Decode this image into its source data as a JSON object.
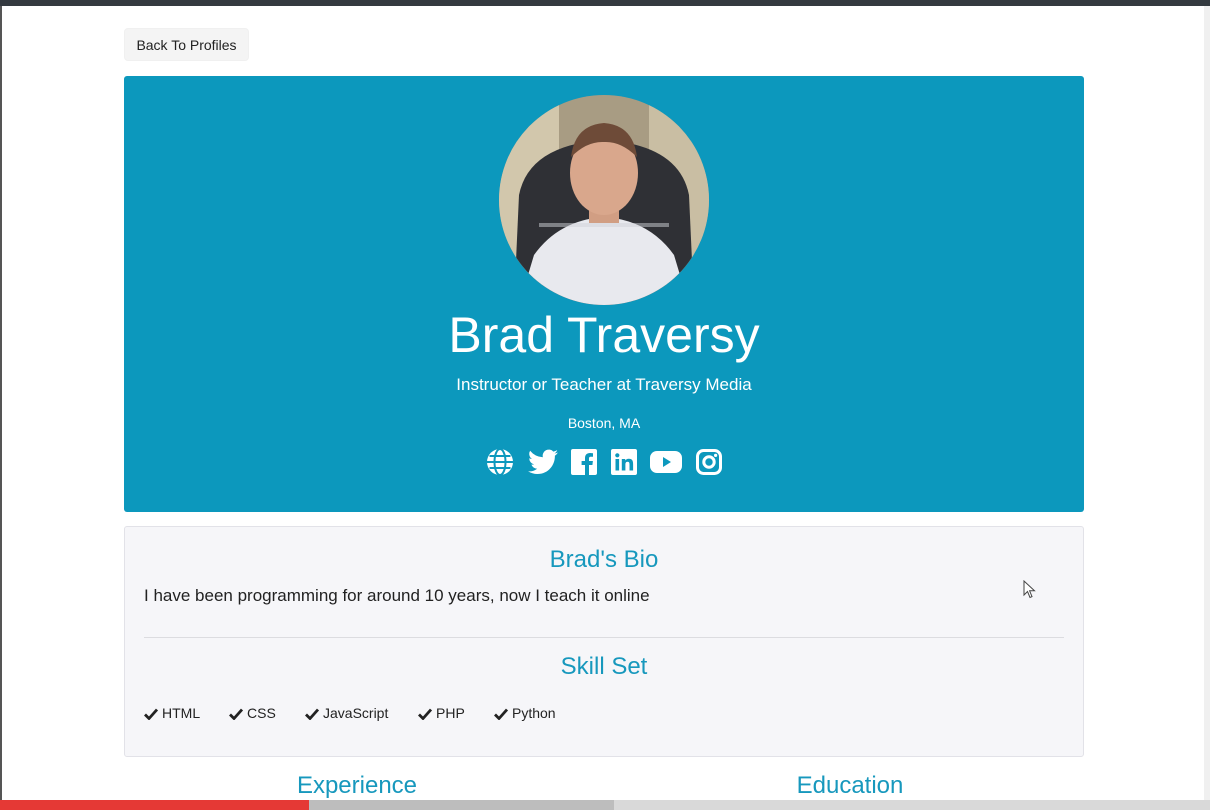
{
  "nav": {
    "back_label": "Back To Profiles"
  },
  "profile": {
    "name": "Brad Traversy",
    "status": "Instructor or Teacher at Traversy Media",
    "location": "Boston, MA",
    "socials": [
      "globe-icon",
      "twitter-icon",
      "facebook-icon",
      "linkedin-icon",
      "youtube-icon",
      "instagram-icon"
    ]
  },
  "about": {
    "bio_heading": "Brad's Bio",
    "bio": "I have been programming for around 10 years, now I teach it online",
    "skills_heading": "Skill Set",
    "skills": [
      "HTML",
      "CSS",
      "JavaScript",
      "PHP",
      "Python"
    ]
  },
  "sections": {
    "experience": "Experience",
    "education": "Education"
  },
  "colors": {
    "accent": "#0c98bd",
    "heading": "#1798bd",
    "progress": "#e53935"
  },
  "video_progress": 0.255
}
